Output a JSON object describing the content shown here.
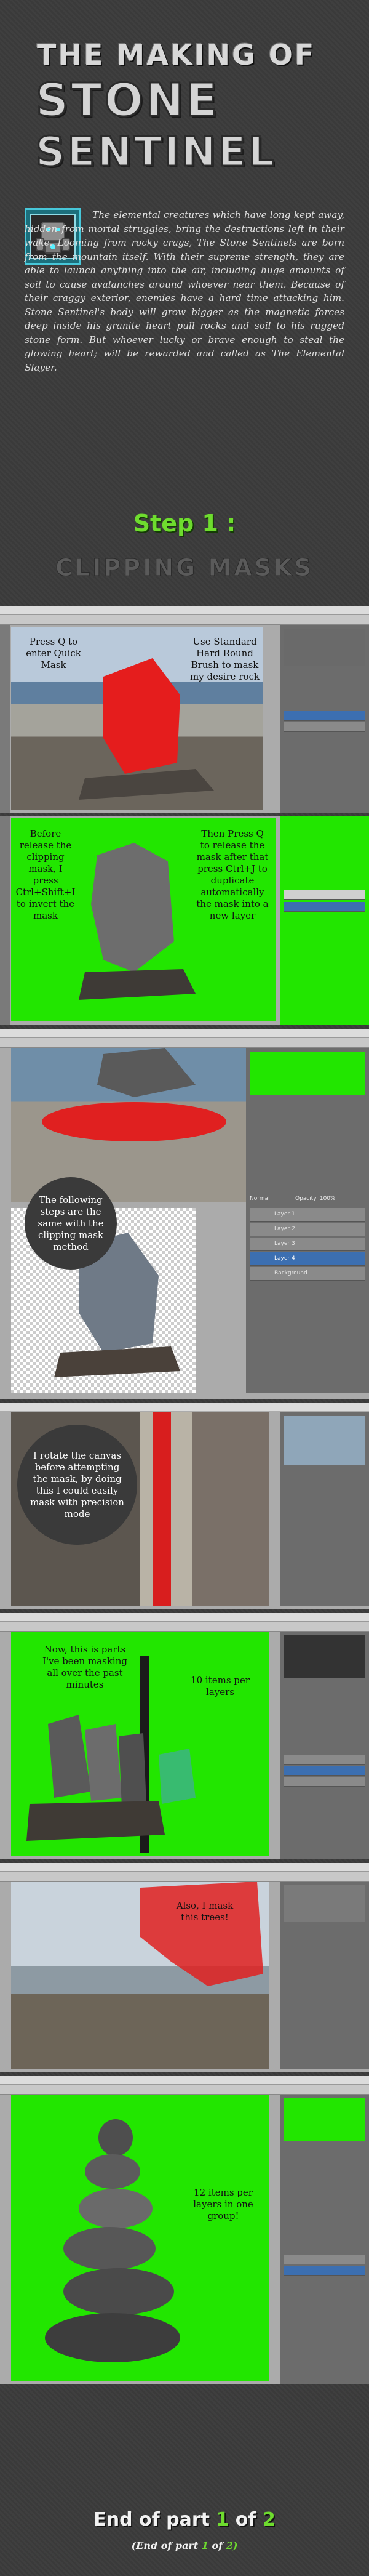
{
  "header": {
    "line1": "THE MAKING OF",
    "line2": "STONE",
    "line3": "SENTINEL"
  },
  "intro": {
    "text": "The elemental creatures which have long kept away, hidden from mortal struggles, bring the destructions left in their wake. Looming from rocky crags, The Stone Sentinels are born from the mountain itself. With their supreme strength, they are able to launch anything into the air, including huge amounts of soil to cause avalanches around whoever near them. Because of their craggy exterior, enemies have a hard time attacking him. Stone Sentinel's body will grow bigger as the magnetic forces deep inside his granite heart pull rocks and soil to his rugged stone form. But whoever lucky or brave enough to steal the glowing heart; will be rewarded and called as The Elemental Slayer."
  },
  "step": {
    "label": "Step 1 :",
    "title": "CLIPPING MASKS"
  },
  "notes": {
    "n1a": "Press Q to enter Quick Mask",
    "n1b": "Use Standard Hard Round Brush to mask my desire rock",
    "n2a": "Before release the clipping mask, I press Ctrl+Shift+I to invert the mask",
    "n2b": "Then Press Q to release the mask after that press Ctrl+J to duplicate automatically the mask into a new layer",
    "n3": "The following steps are the same with the clipping mask method",
    "n4": "I rotate the canvas before attempting the mask, by doing this I could easily mask with precision mode",
    "n5a": "Now, this is parts I've been masking all over the past minutes",
    "n5b": "10 items per layers",
    "n6": "Also, I mask this trees!",
    "n7": "12 items per layers in one group!"
  },
  "layers": {
    "l1": "Layer 1",
    "l2": "Layer 2",
    "l3": "Layer 3",
    "l4": "Layer 4",
    "bg": "Background",
    "mode": "Normal",
    "opacity": "Opacity: 100%"
  },
  "footer": {
    "end_pre": "End of part",
    "end_num": "1",
    "end_of": "of",
    "end_total": "2",
    "sub_pre": "(End of part",
    "sub_num": "1",
    "sub_of": "of",
    "sub_total": "2)"
  },
  "colors": {
    "accent_green": "#6edc2e",
    "screen_green": "#22e600",
    "mask_red": "#e02020",
    "badge_cyan": "#47c7d9"
  }
}
